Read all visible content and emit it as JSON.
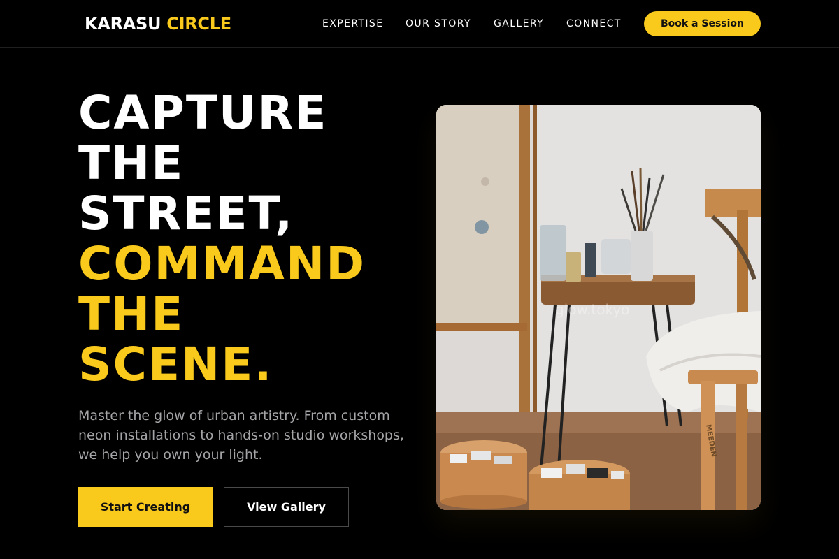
{
  "header": {
    "brand_primary": "KARASU",
    "brand_accent": "CIRCLE",
    "nav": [
      {
        "label": "EXPERTISE"
      },
      {
        "label": "OUR STORY"
      },
      {
        "label": "GALLERY"
      },
      {
        "label": "CONNECT"
      }
    ],
    "cta_label": "Book a Session"
  },
  "hero": {
    "headline_white": [
      "CAPTURE",
      "THE",
      "STREET,"
    ],
    "headline_yellow": [
      "COMMAND",
      "THE",
      "SCENE."
    ],
    "lead": "Master the glow of urban artistry. From custom neon installations to hands-on studio workshops, we help you own your light.",
    "primary_button": "Start Creating",
    "secondary_button": "View Gallery",
    "image": {
      "subject": "artist studio with paint brushes, easel and stool",
      "watermark": "glow.tokyo",
      "stool_text": "MEEDEN"
    }
  },
  "colors": {
    "background": "#000000",
    "accent": "#f9c91c",
    "muted_text": "#a5a5a8"
  }
}
